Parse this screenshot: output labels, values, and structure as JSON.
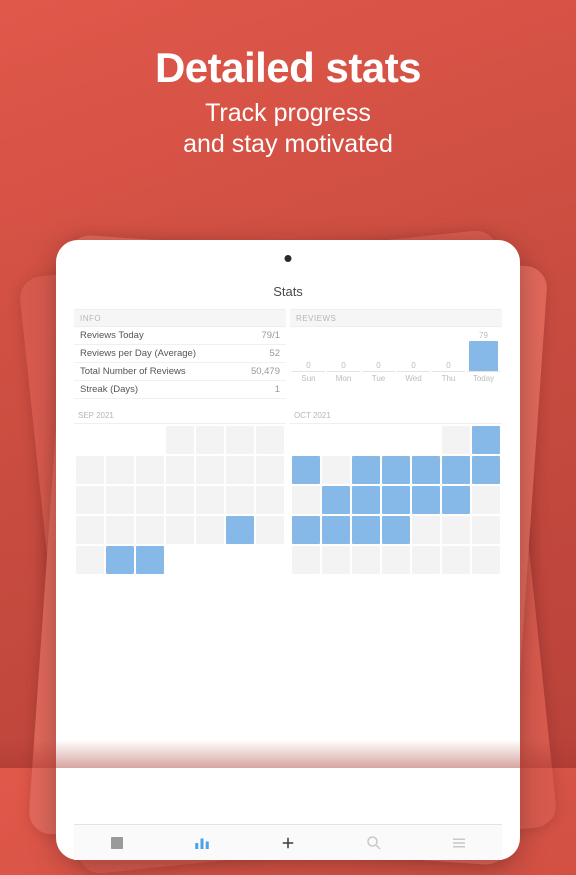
{
  "hero": {
    "title": "Detailed stats",
    "subtitle1": "Track progress",
    "subtitle2": "and stay motivated"
  },
  "screen": {
    "title": "Stats",
    "info_header": "INFO",
    "info": [
      {
        "label": "Reviews Today",
        "value": "79/1"
      },
      {
        "label": "Reviews per Day (Average)",
        "value": "52"
      },
      {
        "label": "Total Number of Reviews",
        "value": "50,479"
      },
      {
        "label": "Streak (Days)",
        "value": "1"
      }
    ],
    "reviews_header": "REVIEWS",
    "months": [
      {
        "label": "SEP 2021"
      },
      {
        "label": "OCT 2021"
      }
    ]
  },
  "chart_data": {
    "type": "bar",
    "categories": [
      "Sun",
      "Mon",
      "Tue",
      "Wed",
      "Thu",
      "Today"
    ],
    "values": [
      0,
      0,
      0,
      0,
      0,
      79
    ],
    "ylim": [
      0,
      79
    ]
  },
  "calendar_data": {
    "sep2021": [
      0,
      0,
      0,
      2,
      2,
      2,
      2,
      2,
      2,
      2,
      2,
      2,
      2,
      2,
      2,
      2,
      2,
      2,
      2,
      2,
      2,
      2,
      2,
      2,
      2,
      2,
      1,
      2,
      2,
      1,
      1,
      0,
      0,
      0,
      0
    ],
    "oct2021": [
      0,
      0,
      0,
      0,
      0,
      2,
      1,
      1,
      2,
      1,
      1,
      1,
      1,
      1,
      2,
      1,
      1,
      1,
      1,
      1,
      2,
      1,
      1,
      1,
      1,
      2,
      2,
      2,
      2,
      2,
      2,
      2,
      2,
      2,
      2
    ]
  },
  "tabs": {
    "library_icon": "book",
    "stats_icon": "bars",
    "add_icon": "plus",
    "search_icon": "search",
    "settings_icon": "menu"
  }
}
